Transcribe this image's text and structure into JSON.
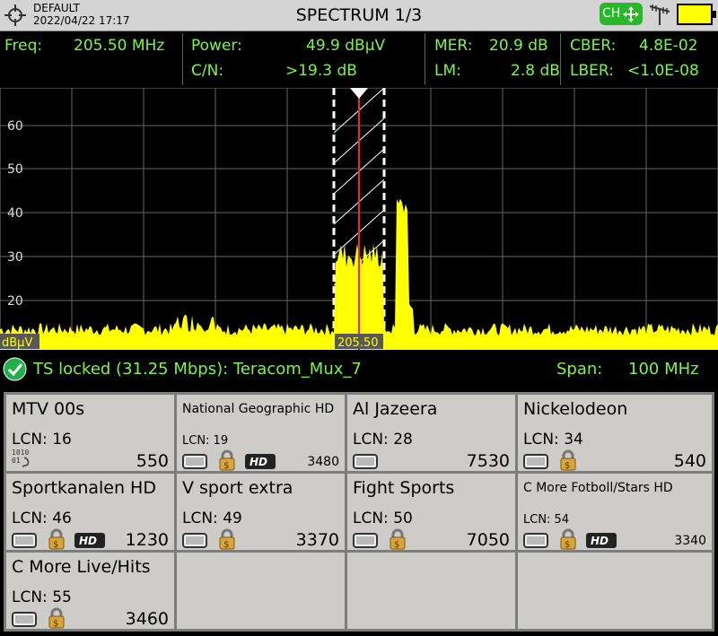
{
  "header": {
    "profile": "DEFAULT",
    "datetime": "2022/04/22 17:17",
    "title": "SPECTRUM 1/3",
    "ch_badge": "CH"
  },
  "measurements": {
    "freq_label": "Freq:",
    "freq_value": "205.50 MHz",
    "power_label": "Power:",
    "power_value": "49.9 dBµV",
    "cn_label": "C/N:",
    "cn_value": ">19.3 dB",
    "mer_label": "MER:",
    "mer_value": "20.9 dB",
    "lm_label": "LM:",
    "lm_value": "2.8 dB",
    "cber_label": "CBER:",
    "cber_value": "4.8E-02",
    "lber_label": "LBER:",
    "lber_value": "<1.0E-08"
  },
  "spectrum": {
    "y_ticks": [
      "60",
      "50",
      "40",
      "30",
      "20"
    ],
    "unit": "dBµV",
    "marker_label": "205.50"
  },
  "status": {
    "ts_text": "TS locked (31.25 Mbps): Teracom_Mux_7",
    "span_label": "Span:",
    "span_value": "100 MHz"
  },
  "channels": [
    {
      "name": "MTV 00s",
      "lcn": "LCN: 16",
      "pid": "550",
      "data": true,
      "tv": false,
      "lock": false,
      "hd": false
    },
    {
      "name": "National Geographic HD",
      "lcn": "LCN: 19",
      "pid": "3480",
      "data": false,
      "tv": true,
      "lock": true,
      "hd": true,
      "small": true
    },
    {
      "name": "Al Jazeera",
      "lcn": "LCN: 28",
      "pid": "7530",
      "data": false,
      "tv": true,
      "lock": false,
      "hd": false
    },
    {
      "name": "Nickelodeon",
      "lcn": "LCN: 34",
      "pid": "540",
      "data": false,
      "tv": true,
      "lock": true,
      "hd": false
    },
    {
      "name": "Sportkanalen HD",
      "lcn": "LCN: 46",
      "pid": "1230",
      "data": false,
      "tv": true,
      "lock": true,
      "hd": true
    },
    {
      "name": "V sport extra",
      "lcn": "LCN: 49",
      "pid": "3370",
      "data": false,
      "tv": true,
      "lock": true,
      "hd": false
    },
    {
      "name": "Fight Sports",
      "lcn": "LCN: 50",
      "pid": "7050",
      "data": false,
      "tv": true,
      "lock": true,
      "hd": false
    },
    {
      "name": "C More Fotboll/Stars HD",
      "lcn": "LCN: 54",
      "pid": "3340",
      "data": false,
      "tv": true,
      "lock": true,
      "hd": true,
      "small": true
    },
    {
      "name": "C More Live/Hits",
      "lcn": "LCN: 55",
      "pid": "3460",
      "data": false,
      "tv": true,
      "lock": true,
      "hd": false
    }
  ],
  "colors": {
    "trace": "#ffff00",
    "text_green": "#7df542",
    "marker": "#ff2222",
    "badge": "#27b727"
  }
}
